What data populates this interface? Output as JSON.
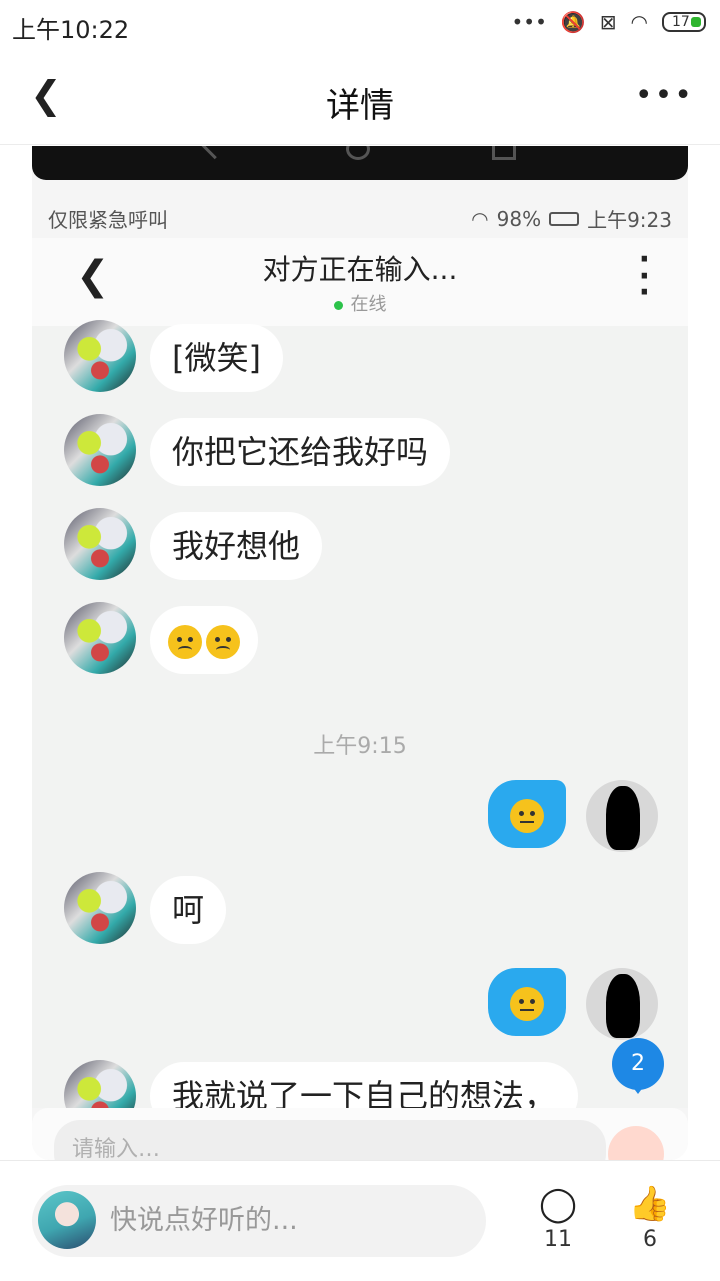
{
  "status_bar": {
    "time": "上午10:22",
    "battery": "17"
  },
  "header": {
    "title": "详情"
  },
  "screenshot": {
    "status_left": "仅限紧急呼叫",
    "status_battery": "98%",
    "status_time": "上午9:23",
    "contact_status": "对方正在输入...",
    "online_label": "在线",
    "messages": [
      {
        "side": "left",
        "text": "[微笑]"
      },
      {
        "side": "left",
        "text": "你把它还给我好吗"
      },
      {
        "side": "left",
        "text": "我好想他"
      },
      {
        "side": "left",
        "emoji": [
          "sad-emoji",
          "sad-emoji"
        ]
      },
      {
        "side": "right",
        "emoji": [
          "neutral-emoji"
        ]
      },
      {
        "side": "left",
        "text": "呵"
      },
      {
        "side": "right",
        "emoji": [
          "annoyed-emoji"
        ]
      },
      {
        "side": "left",
        "text": "我就说了一下自己的想法，"
      }
    ],
    "timestamp": "上午9:15",
    "unread_badge": "2",
    "input_placeholder": "请输入…"
  },
  "bottom_bar": {
    "comment_placeholder": "快说点好听的...",
    "comment_count": "11",
    "like_count": "6"
  }
}
